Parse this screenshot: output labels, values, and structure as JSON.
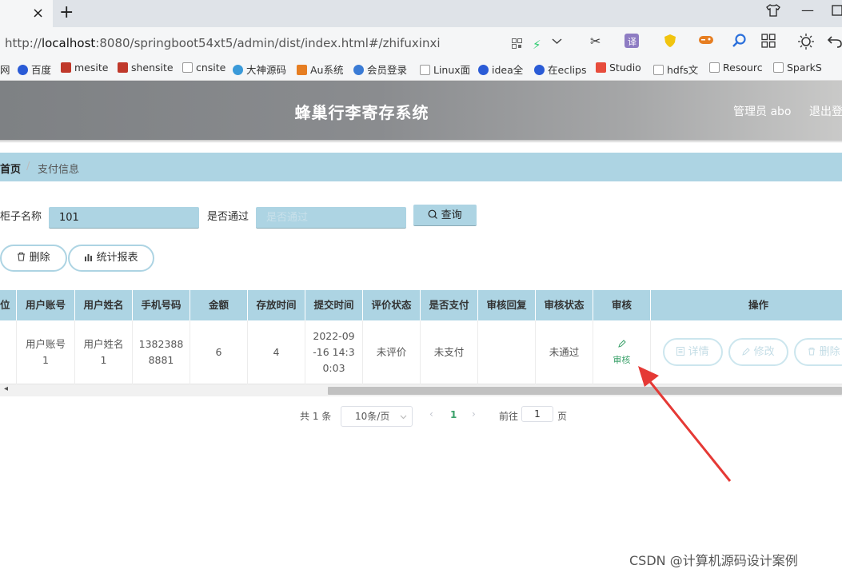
{
  "browser": {
    "url_prefix": "http://",
    "url_host": "localhost",
    "url_rest": ":8080/springboot54xt5/admin/dist/index.html#/zhifuxinxi",
    "new_tab": "+",
    "tab_close": "×"
  },
  "bookmarks": [
    {
      "label": "网",
      "color": ""
    },
    {
      "label": "百度",
      "color": "#2a5bd6"
    },
    {
      "label": "mesite",
      "color": "#c0392b"
    },
    {
      "label": "shensite",
      "color": "#c0392b"
    },
    {
      "label": "cnsite",
      "color": "#bbbbbb"
    },
    {
      "label": "大神源码",
      "color": "#3a9ad9"
    },
    {
      "label": "Au系统",
      "color": "#e67e22"
    },
    {
      "label": "会员登录",
      "color": "#3a7bd5"
    },
    {
      "label": "Linux面",
      "color": "#bbbbbb"
    },
    {
      "label": "idea全",
      "color": "#2a5bd6"
    },
    {
      "label": "在eclips",
      "color": "#2a5bd6"
    },
    {
      "label": "Studio",
      "color": "#e74c3c"
    },
    {
      "label": "hdfs文",
      "color": "#bbbbbb"
    },
    {
      "label": "Resourc",
      "color": "#bbbbbb"
    },
    {
      "label": "SparkS",
      "color": "#bbbbbb"
    }
  ],
  "header": {
    "title": "蜂巢行李寄存系统",
    "admin": "管理员 abo",
    "logout": "退出登"
  },
  "breadcrumb": {
    "home": "首页",
    "separator": "/",
    "current": "支付信息"
  },
  "search": {
    "cabinet_label": "柜子名称",
    "cabinet_value": "101",
    "passed_label": "是否通过",
    "passed_placeholder": "是否通过",
    "query_button": "查询"
  },
  "actions": {
    "delete": "删除",
    "report": "统计报表"
  },
  "table": {
    "columns": [
      "位",
      "用户账号",
      "用户姓名",
      "手机号码",
      "金额",
      "存放时间",
      "提交时间",
      "评价状态",
      "是否支付",
      "审核回复",
      "审核状态",
      "审核",
      "操作"
    ],
    "row": {
      "account": [
        "用户账号",
        "1"
      ],
      "name": [
        "用户姓名",
        "1"
      ],
      "phone": [
        "1382388",
        "8881"
      ],
      "amount": "6",
      "storage_time": "4",
      "submit_time": [
        "2022-09",
        "-16 14:3",
        "0:03"
      ],
      "review_status": "未评价",
      "paid": "未支付",
      "audit_reply": "",
      "audit_status": "未通过",
      "audit_link": "审核",
      "op_detail": "详情",
      "op_edit": "修改",
      "op_delete": "删除"
    }
  },
  "pagination": {
    "total": "共 1 条",
    "page_size": "10条/页",
    "current_page": "1",
    "goto_label": "前往",
    "goto_value": "1",
    "page_suffix": "页"
  },
  "watermark": "CSDN @计算机源码设计案例",
  "colors": {
    "accent": "#add4e3",
    "audit_link": "#3aa16a",
    "annotation_arrow": "#e53935"
  }
}
